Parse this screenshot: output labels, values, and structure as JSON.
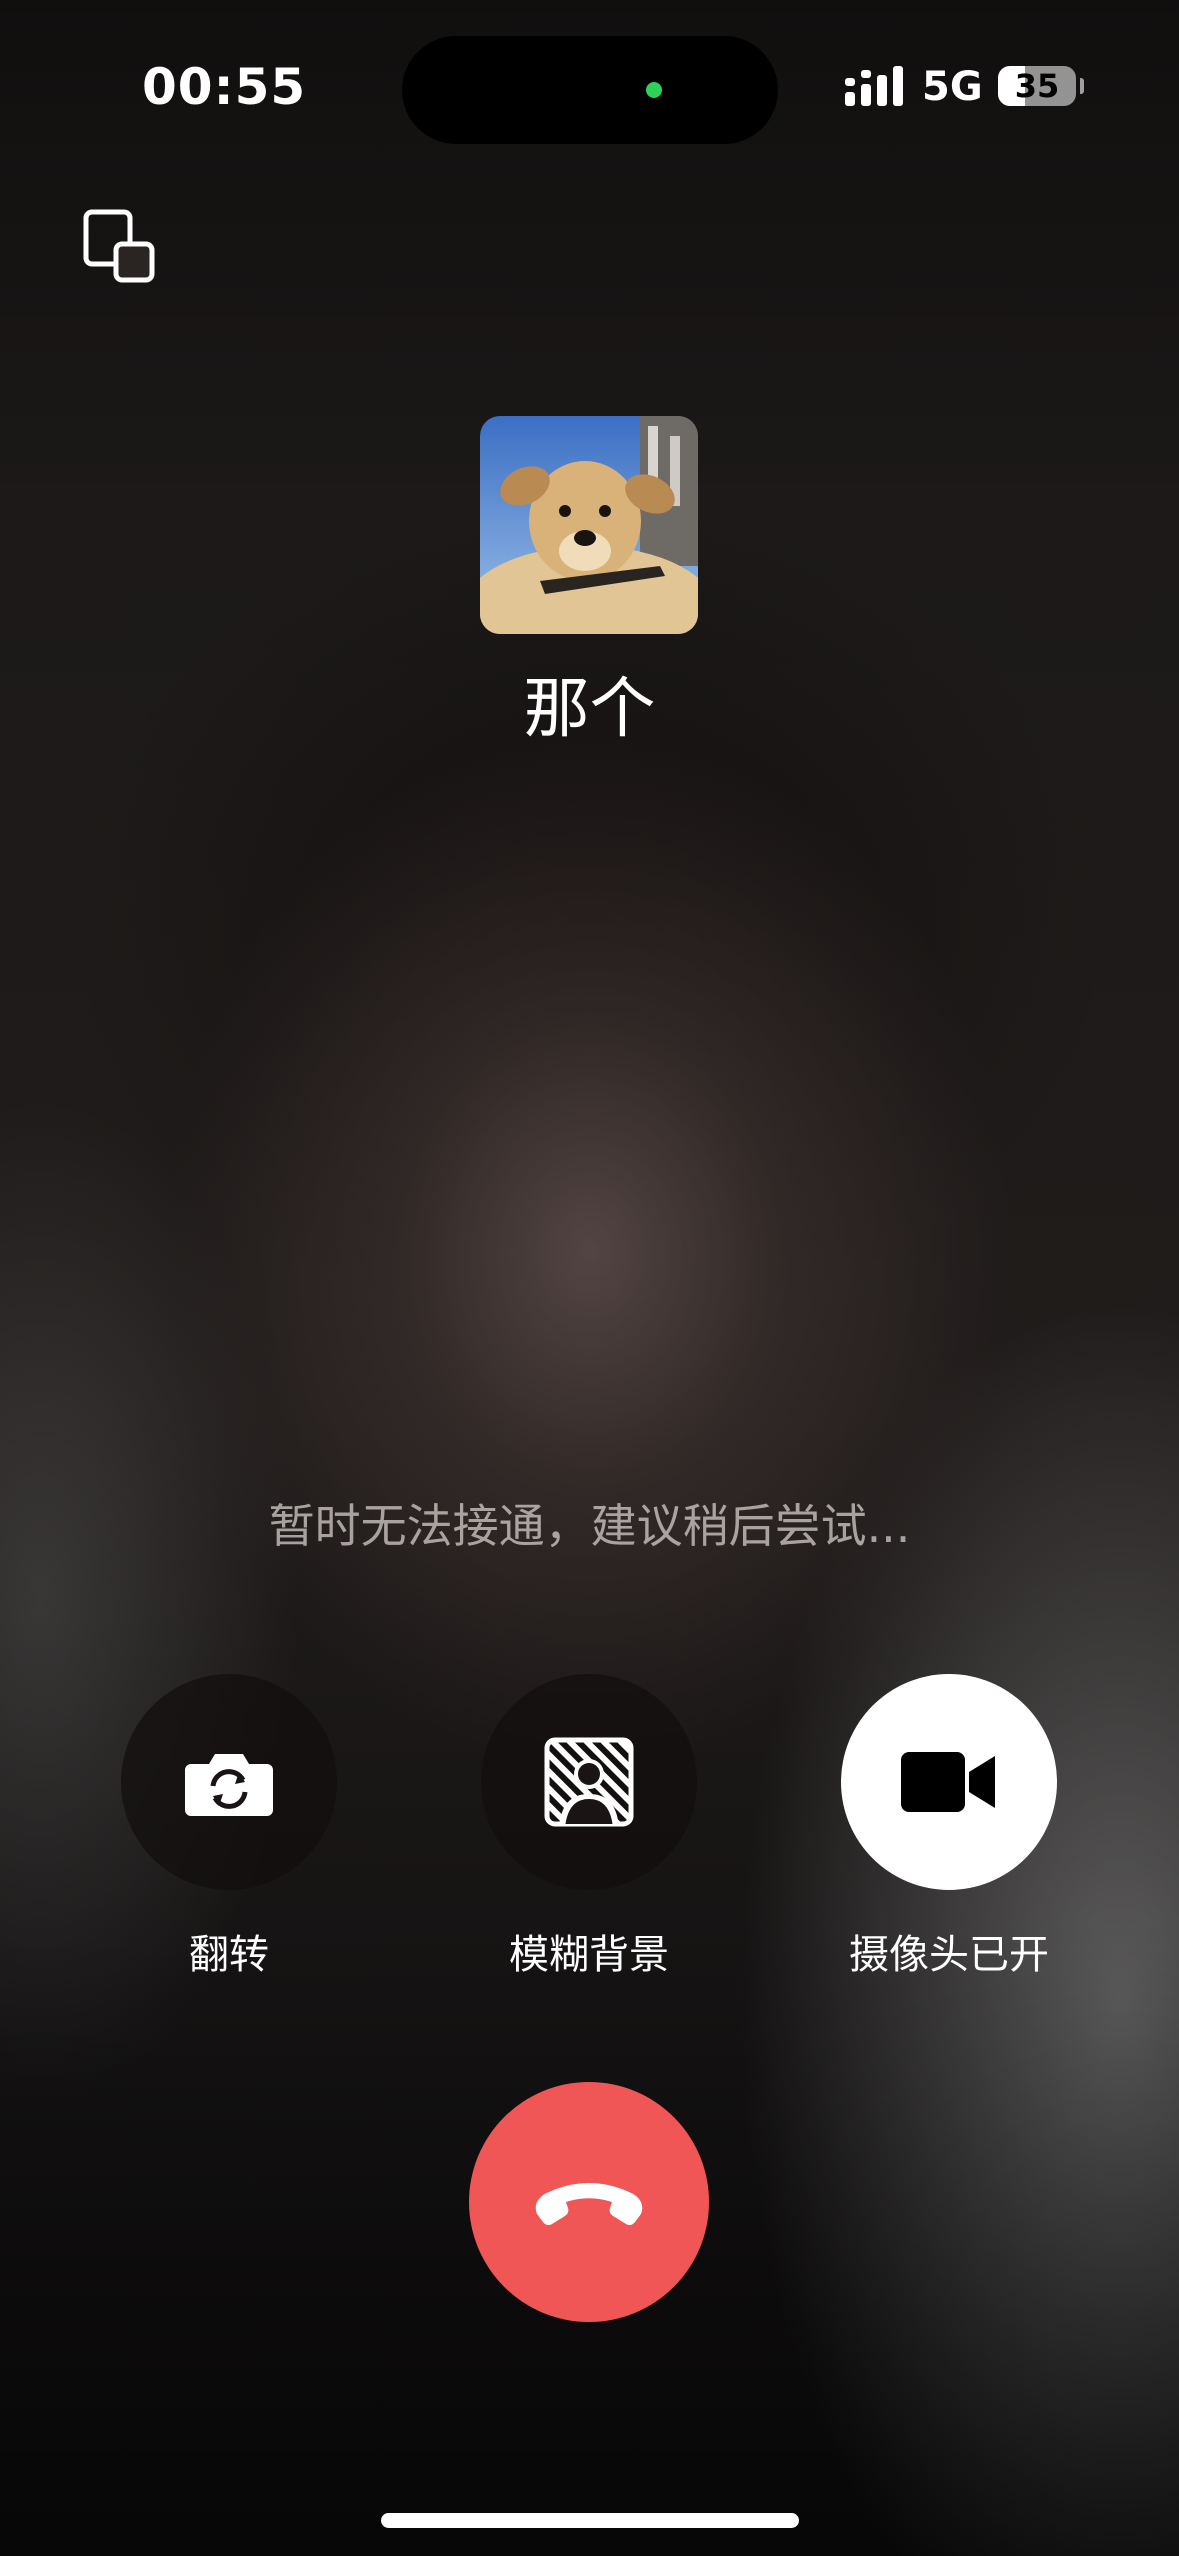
{
  "status_bar": {
    "time": "00:55",
    "network": "5G",
    "battery": "35",
    "battery_fraction": 0.35
  },
  "caller": {
    "name": "那个",
    "avatar_icon": "dog-photo-avatar"
  },
  "call_status": "暂时无法接通，建议稍后尝试...",
  "controls": [
    {
      "label": "翻转",
      "icon": "flip-camera-icon"
    },
    {
      "label": "模糊背景",
      "icon": "blur-background-icon"
    },
    {
      "label": "摄像头已开",
      "icon": "video-camera-icon"
    }
  ],
  "hangup": {
    "icon": "phone-hangup-icon",
    "color": "#f05656"
  },
  "colors": {
    "accent_green": "#2fd158",
    "hangup_red": "#f05656"
  }
}
